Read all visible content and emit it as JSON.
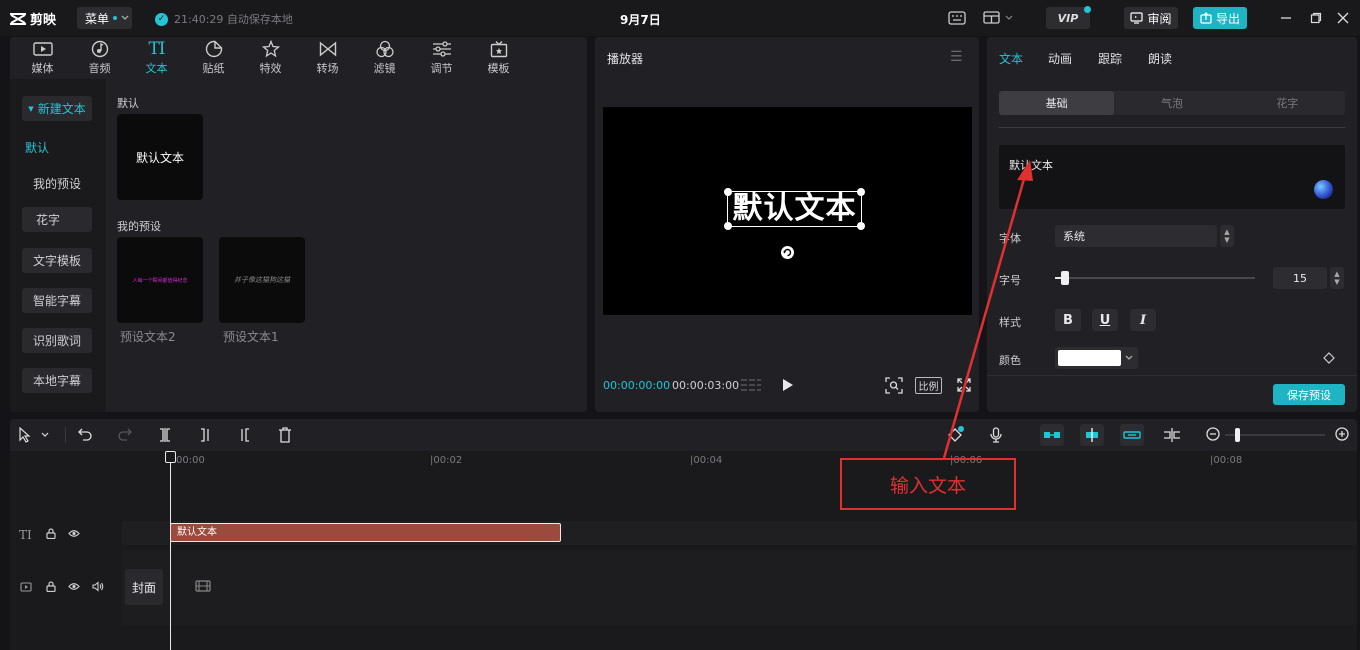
{
  "app": {
    "name": "剪映"
  },
  "titlebar": {
    "menu_label": "菜单",
    "autosave_text": "21:40:29 自动保存本地",
    "title": "9月7日",
    "vip_label": "VIP",
    "review_label": "审阅",
    "export_label": "导出"
  },
  "media_tabs": [
    {
      "label": "媒体"
    },
    {
      "label": "音频"
    },
    {
      "label": "文本"
    },
    {
      "label": "贴纸"
    },
    {
      "label": "特效"
    },
    {
      "label": "转场"
    },
    {
      "label": "滤镜"
    },
    {
      "label": "调节"
    },
    {
      "label": "模板"
    }
  ],
  "text_nav": {
    "items": [
      {
        "label": "新建文本"
      },
      {
        "label": "默认"
      },
      {
        "label": "我的预设"
      },
      {
        "label": "花字"
      },
      {
        "label": "文字模板"
      },
      {
        "label": "智能字幕"
      },
      {
        "label": "识别歌词"
      },
      {
        "label": "本地字幕"
      }
    ]
  },
  "text_content": {
    "default_section": "默认",
    "default_thumb": "默认文本",
    "preset_section": "我的预设",
    "presets": [
      {
        "caption": "预设文本2",
        "sample": "人每一个瞬间都值得纪念"
      },
      {
        "caption": "预设文本1",
        "sample": "井子像这猫狗这猫"
      }
    ]
  },
  "player": {
    "title": "播放器",
    "overlay_text": "默认文本",
    "time_current": "00:00:00:00",
    "time_total": "00:00:03:00",
    "ratio_label": "比例"
  },
  "inspector": {
    "tabs": [
      {
        "label": "文本"
      },
      {
        "label": "动画"
      },
      {
        "label": "跟踪"
      },
      {
        "label": "朗读"
      }
    ],
    "segments": [
      {
        "label": "基础"
      },
      {
        "label": "气泡"
      },
      {
        "label": "花字"
      }
    ],
    "text_value": "默认文本",
    "font_label": "字体",
    "font_value": "系统",
    "size_label": "字号",
    "size_value": "15",
    "size_fraction": 0.05,
    "style_label": "样式",
    "bold": "B",
    "underline": "U",
    "italic": "I",
    "color_label": "颜色",
    "color_value": "#ffffff",
    "save_preset_label": "保存预设"
  },
  "timeline": {
    "ruler": [
      "00:00",
      "00:02",
      "00:04",
      "00:06",
      "00:08"
    ],
    "text_clip": "默认文本",
    "cover_label": "封面"
  },
  "annotation": {
    "label": "输入文本",
    "color": "#e03030"
  },
  "colors": {
    "accent": "#23c4d4",
    "clip": "#9b4a3c"
  }
}
